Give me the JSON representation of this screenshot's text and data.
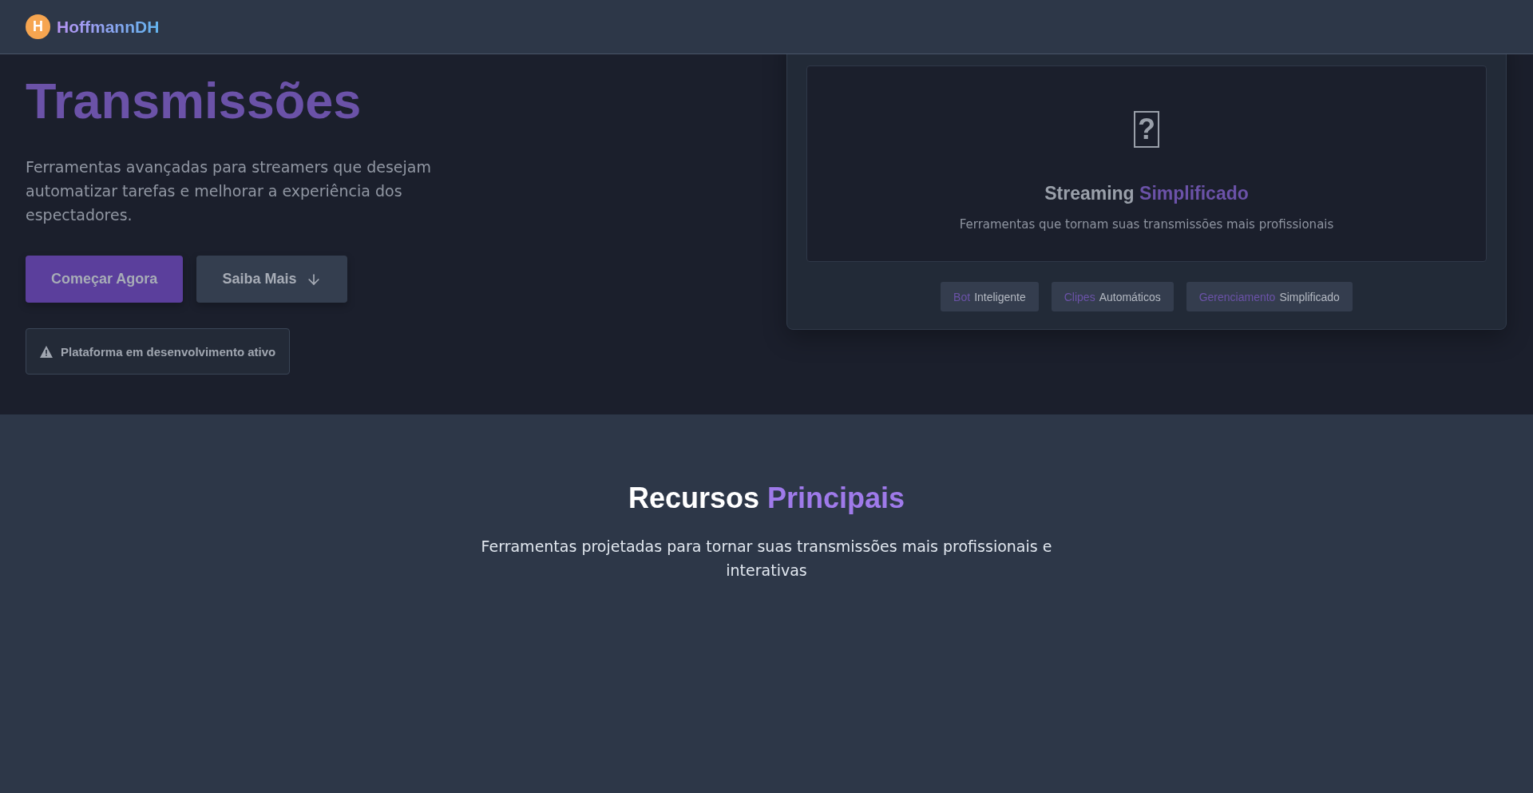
{
  "header": {
    "logo_letter": "H",
    "brand": "HoffmannDH"
  },
  "hero": {
    "title_accent": "Transmissões",
    "description": "Ferramentas avançadas para streamers que desejam automatizar tarefas e melhorar a experiência dos espectadores.",
    "buttons": [
      {
        "label": "Começar Agora",
        "kind": "primary"
      },
      {
        "label": "Saiba Mais",
        "kind": "secondary"
      }
    ],
    "notice": "Plataforma em desenvolvimento ativo"
  },
  "showcase": {
    "glyph": "?",
    "title": "Streaming",
    "title_accent": "Simplificado",
    "subtitle": "Ferramentas que tornam suas transmissões mais profissionais",
    "tags": [
      {
        "accent": "Bot",
        "text": "Inteligente"
      },
      {
        "accent": "Clipes",
        "text": "Automáticos"
      },
      {
        "accent": "Gerenciamento",
        "text": "Simplificado"
      }
    ]
  },
  "features": {
    "title": "Recursos",
    "title_accent": "Principais",
    "description": "Ferramentas projetadas para tornar suas transmissões mais profissionais e interativas"
  }
}
